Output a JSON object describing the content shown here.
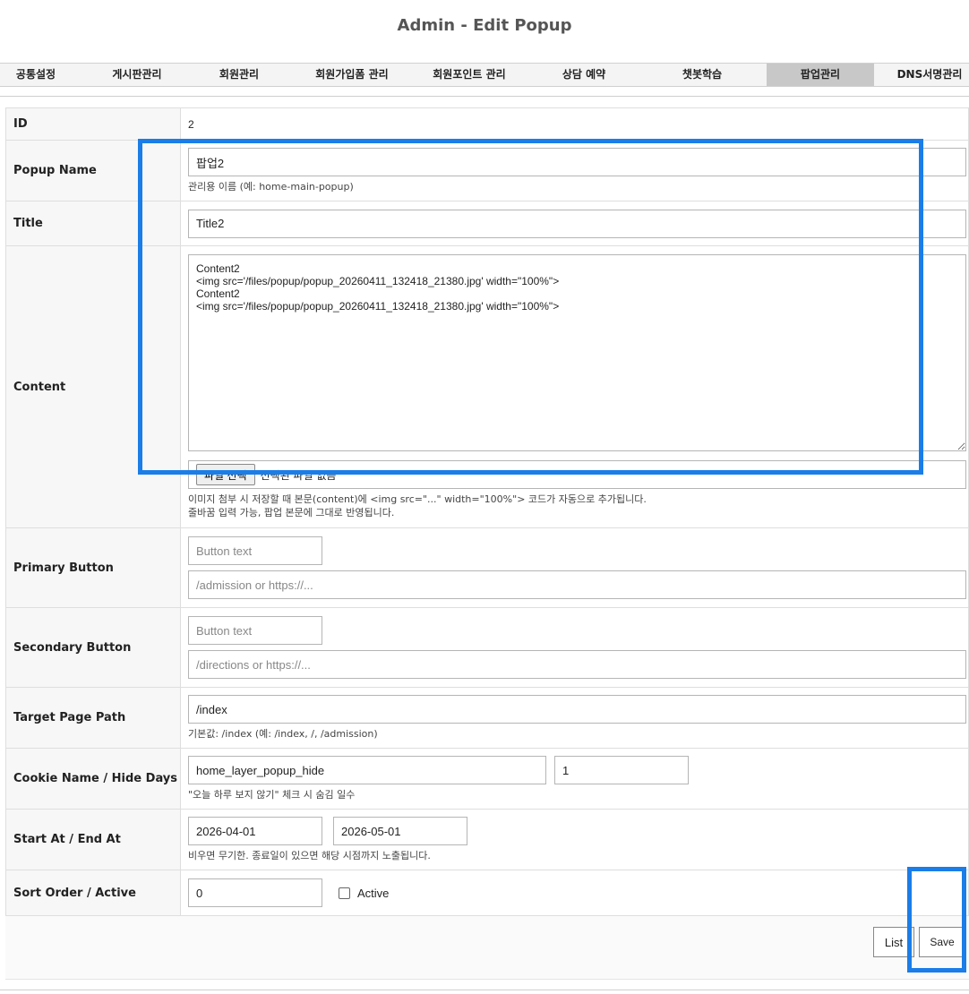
{
  "page": {
    "title": "Admin - Edit Popup"
  },
  "nav": {
    "tabs": [
      {
        "label": "공통설정"
      },
      {
        "label": "게시판관리"
      },
      {
        "label": "회원관리"
      },
      {
        "label": "회원가입폼 관리"
      },
      {
        "label": "회원포인트 관리"
      },
      {
        "label": "상담 예약"
      },
      {
        "label": "챗봇학습"
      },
      {
        "label": "팝업관리"
      },
      {
        "label": "DNS서명관리"
      }
    ],
    "active_index": 7
  },
  "form": {
    "id": {
      "label": "ID",
      "value": "2"
    },
    "popup_name": {
      "label": "Popup Name",
      "value": "팝업2",
      "help": "관리용 이름 (예: home-main-popup)"
    },
    "title": {
      "label": "Title",
      "value": "Title2"
    },
    "content": {
      "label": "Content",
      "value": "Content2\n<img src='/files/popup/popup_20260411_132418_21380.jpg' width=\"100%\">\nContent2\n<img src='/files/popup/popup_20260411_132418_21380.jpg' width=\"100%\">",
      "file_button": "파일 선택",
      "file_status": "선택된 파일 없음",
      "help1": "이미지 첨부 시 저장할 때 본문(content)에 <img src=\"...\" width=\"100%\"> 코드가 자동으로 추가됩니다.",
      "help2": "줄바꿈 입력 가능, 팝업 본문에 그대로 반영됩니다."
    },
    "primary_button": {
      "label": "Primary Button",
      "text_placeholder": "Button text",
      "link_placeholder": "/admission or https://..."
    },
    "secondary_button": {
      "label": "Secondary Button",
      "text_placeholder": "Button text",
      "link_placeholder": "/directions or https://..."
    },
    "target_path": {
      "label": "Target Page Path",
      "value": "/index",
      "help": "기본값: /index (예: /index, /, /admission)"
    },
    "cookie": {
      "label": "Cookie Name / Hide Days",
      "name_value": "home_layer_popup_hide",
      "days_value": "1",
      "help": "\"오늘 하루 보지 않기\" 체크 시 숨김 일수"
    },
    "dates": {
      "label": "Start At / End At",
      "start_value": "2026-04-01",
      "end_value": "2026-05-01",
      "help": "비우면 무기한. 종료일이 있으면 해당 시점까지 노출됩니다."
    },
    "sort": {
      "label": "Sort Order / Active",
      "value": "0",
      "active_label": "Active",
      "active_checked": false
    }
  },
  "actions": {
    "list_label": "List",
    "save_label": "Save"
  },
  "colors": {
    "highlight": "#1a7de8",
    "active_tab": "#c8c8c8"
  }
}
